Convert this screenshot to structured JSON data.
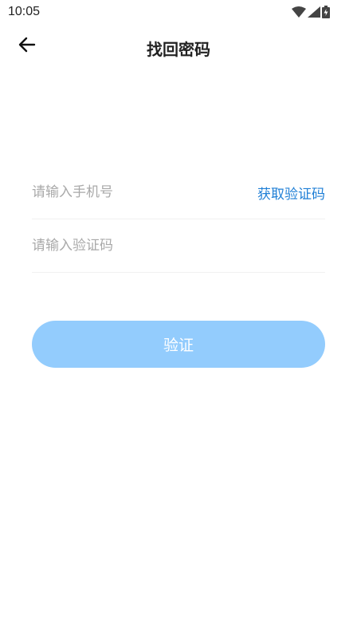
{
  "status_bar": {
    "time": "10:05",
    "icons": [
      "wifi-icon",
      "signal-icon",
      "battery-icon"
    ]
  },
  "header": {
    "title": "找回密码",
    "back_icon": "arrow-left-icon"
  },
  "form": {
    "phone_placeholder": "请输入手机号",
    "phone_value": "",
    "code_placeholder": "请输入验证码",
    "code_value": "",
    "get_code_label": "获取验证码"
  },
  "verify_button": {
    "label": "验证"
  },
  "colors": {
    "accent_link": "#1f7fd6",
    "button_bg": "#93ccfd",
    "placeholder": "#a9a9a9"
  }
}
